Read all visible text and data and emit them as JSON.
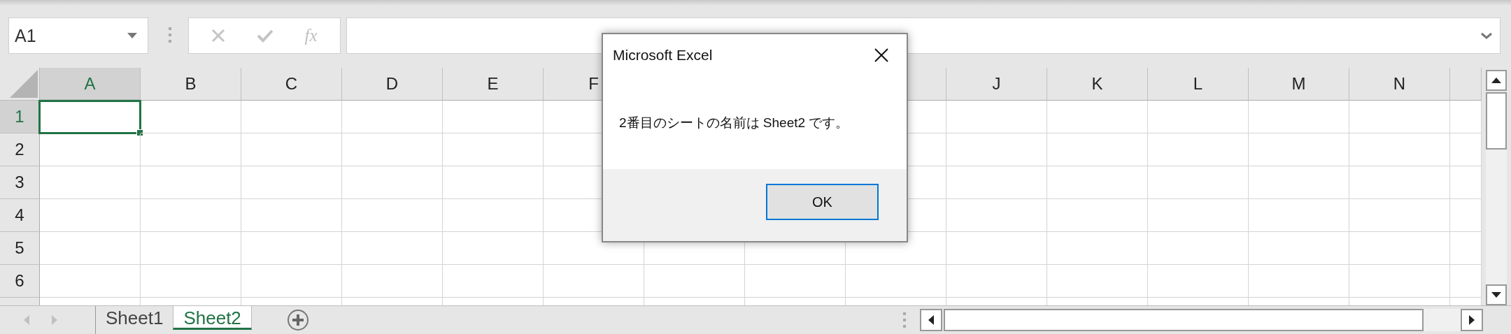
{
  "name_box": {
    "value": "A1"
  },
  "formula_bar": {
    "function_label": "fx"
  },
  "columns": [
    {
      "label": "A",
      "selected": true
    },
    {
      "label": "B",
      "selected": false
    },
    {
      "label": "C",
      "selected": false
    },
    {
      "label": "D",
      "selected": false
    },
    {
      "label": "E",
      "selected": false
    },
    {
      "label": "F",
      "selected": false
    },
    {},
    {},
    {},
    {
      "label": "J",
      "selected": false
    },
    {
      "label": "K",
      "selected": false
    },
    {
      "label": "L",
      "selected": false
    },
    {
      "label": "M",
      "selected": false
    },
    {
      "label": "N",
      "selected": false
    },
    {}
  ],
  "rows": [
    {
      "label": "1",
      "selected": true
    },
    {
      "label": "2",
      "selected": false
    },
    {
      "label": "3",
      "selected": false
    },
    {
      "label": "4",
      "selected": false
    },
    {
      "label": "5",
      "selected": false
    },
    {
      "label": "6",
      "selected": false
    },
    {}
  ],
  "sheet_tabs": [
    {
      "label": "Sheet1",
      "selected": false
    },
    {
      "label": "Sheet2",
      "selected": true
    }
  ],
  "dialog": {
    "title": "Microsoft Excel",
    "message": "2番目のシートの名前は Sheet2 です。",
    "buttons": [
      {
        "label": "OK",
        "default": true
      }
    ]
  }
}
